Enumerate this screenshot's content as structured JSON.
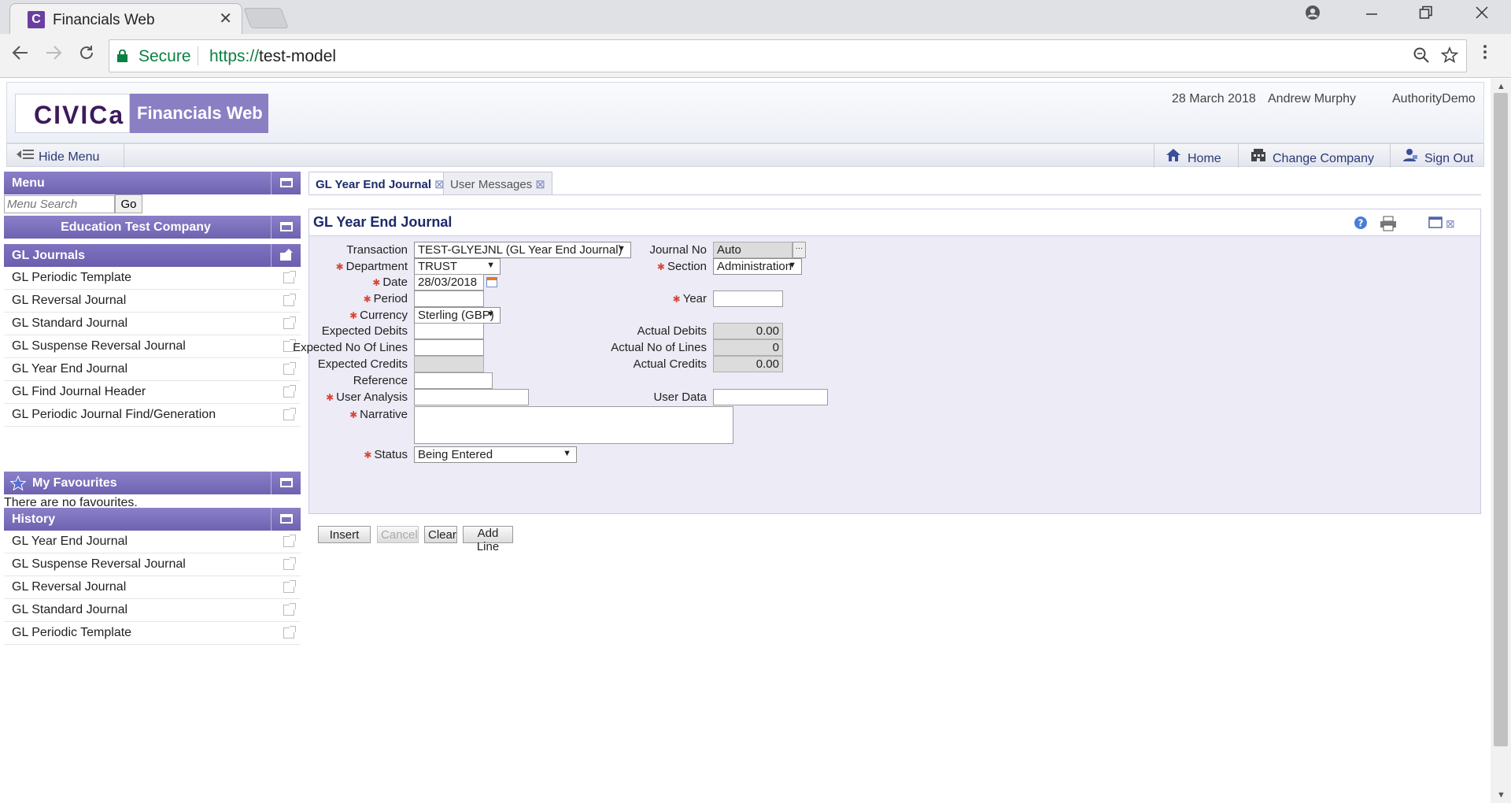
{
  "browser": {
    "tab_title": "Financials Web",
    "tab_close": "✕",
    "favicon_letter": "C",
    "secure_label": "Secure",
    "url_scheme": "https://",
    "url_host": "test-model"
  },
  "banner": {
    "logo_text": "CIVICa",
    "product_name": "Financials Web",
    "date": "28 March 2018",
    "user": "Andrew Murphy",
    "authority": "AuthorityDemo"
  },
  "topbar": {
    "hide_menu": "Hide Menu",
    "home": "Home",
    "change_company": "Change Company",
    "sign_out": "Sign Out"
  },
  "menu": {
    "title": "Menu",
    "search_placeholder": "Menu Search",
    "go_label": "Go",
    "company": "Education Test Company",
    "section": "GL Journals",
    "items": [
      {
        "label": "GL Periodic Template"
      },
      {
        "label": "GL Reversal Journal"
      },
      {
        "label": "GL Standard Journal"
      },
      {
        "label": "GL Suspense Reversal Journal"
      },
      {
        "label": "GL Year End Journal"
      },
      {
        "label": "GL Find Journal Header"
      },
      {
        "label": "GL Periodic Journal Find/Generation"
      }
    ]
  },
  "favourites": {
    "title": "My Favourites",
    "empty_text": "There are no favourites."
  },
  "history": {
    "title": "History",
    "items": [
      {
        "label": "GL Year End Journal"
      },
      {
        "label": "GL Suspense Reversal Journal"
      },
      {
        "label": "GL Reversal Journal"
      },
      {
        "label": "GL Standard Journal"
      },
      {
        "label": "GL Periodic Template"
      }
    ]
  },
  "content_tabs": [
    {
      "label": "GL Year End Journal"
    },
    {
      "label": "User Messages"
    }
  ],
  "form": {
    "title": "GL Year End Journal",
    "labels": {
      "transaction": "Transaction",
      "journal_no": "Journal No",
      "department": "Department",
      "section": "Section",
      "date": "Date",
      "period": "Period",
      "year": "Year",
      "currency": "Currency",
      "expected_debits": "Expected Debits",
      "actual_debits": "Actual Debits",
      "expected_lines": "Expected No Of Lines",
      "actual_lines": "Actual No of Lines",
      "expected_credits": "Expected Credits",
      "actual_credits": "Actual Credits",
      "reference": "Reference",
      "user_analysis": "User Analysis",
      "user_data": "User Data",
      "narrative": "Narrative",
      "status": "Status"
    },
    "values": {
      "transaction": "TEST-GLYEJNL (GL Year End Journal)",
      "journal_no": "Auto",
      "department": "TRUST",
      "section": "Administration",
      "date": "28/03/2018",
      "period": "",
      "year": "",
      "currency": "Sterling (GBP)",
      "expected_debits": "",
      "actual_debits": "0.00",
      "expected_lines": "",
      "actual_lines": "0",
      "expected_credits": "",
      "actual_credits": "0.00",
      "reference": "",
      "user_analysis": "",
      "user_data": "",
      "narrative": "",
      "status": "Being Entered"
    },
    "required_marker": "✱"
  },
  "actions": {
    "insert": "Insert",
    "cancel": "Cancel",
    "clear": "Clear",
    "add_line": "Add Line"
  }
}
